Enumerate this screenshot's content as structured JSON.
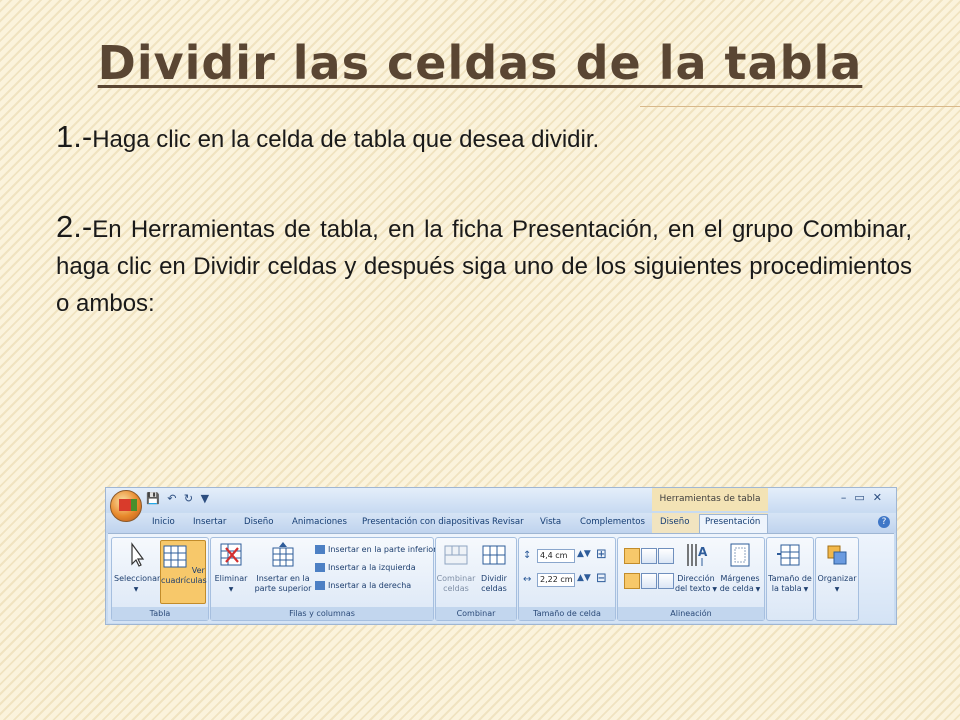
{
  "slide": {
    "title": "Dividir las celdas de la tabla",
    "step1_num": "1.-",
    "step1_text": "Haga clic en la celda de tabla que desea dividir.",
    "step2_num": "2.-",
    "step2_text": "En Herramientas de tabla, en la ficha Presentación, en el grupo Combinar, haga clic en Dividir celdas y después siga uno de los siguientes procedimientos o ambos:"
  },
  "ribbon": {
    "contextual_title": "Herramientas de tabla",
    "active_tab": "Presentación",
    "tabs": [
      "Inicio",
      "Insertar",
      "Diseño",
      "Animaciones",
      "Presentación con diapositivas",
      "Revisar",
      "Vista",
      "Complementos",
      "Diseño",
      "Presentación"
    ],
    "groups": {
      "tabla": {
        "label": "Tabla",
        "seleccionar": "Seleccionar",
        "ver": "Ver",
        "ver2": "cuadrículas"
      },
      "filas": {
        "label": "Filas y columnas",
        "eliminar": "Eliminar",
        "insertar_sup1": "Insertar en la",
        "insertar_sup2": "parte superior",
        "insertar_inf": "Insertar en la parte inferior",
        "insertar_izq": "Insertar a la izquierda",
        "insertar_der": "Insertar a la derecha"
      },
      "combinar": {
        "label": "Combinar",
        "combinar1": "Combinar",
        "combinar2": "celdas",
        "dividir1": "Dividir",
        "dividir2": "celdas"
      },
      "tamano": {
        "label": "Tamaño de celda",
        "height": "4,4 cm",
        "width": "2,22 cm"
      },
      "alineacion": {
        "label": "Alineación",
        "direccion1": "Dirección",
        "direccion2": "del texto",
        "margenes1": "Márgenes",
        "margenes2": "de celda"
      },
      "tamano_tabla": {
        "label1": "Tamaño de",
        "label2": "la tabla"
      },
      "organizar": {
        "label": "Organizar"
      }
    }
  },
  "colors": {
    "title": "#5a4633",
    "ribbon_bg": "#c8dbf1",
    "context_tab": "#f3e3b5",
    "active_button": "#f7c86a"
  }
}
